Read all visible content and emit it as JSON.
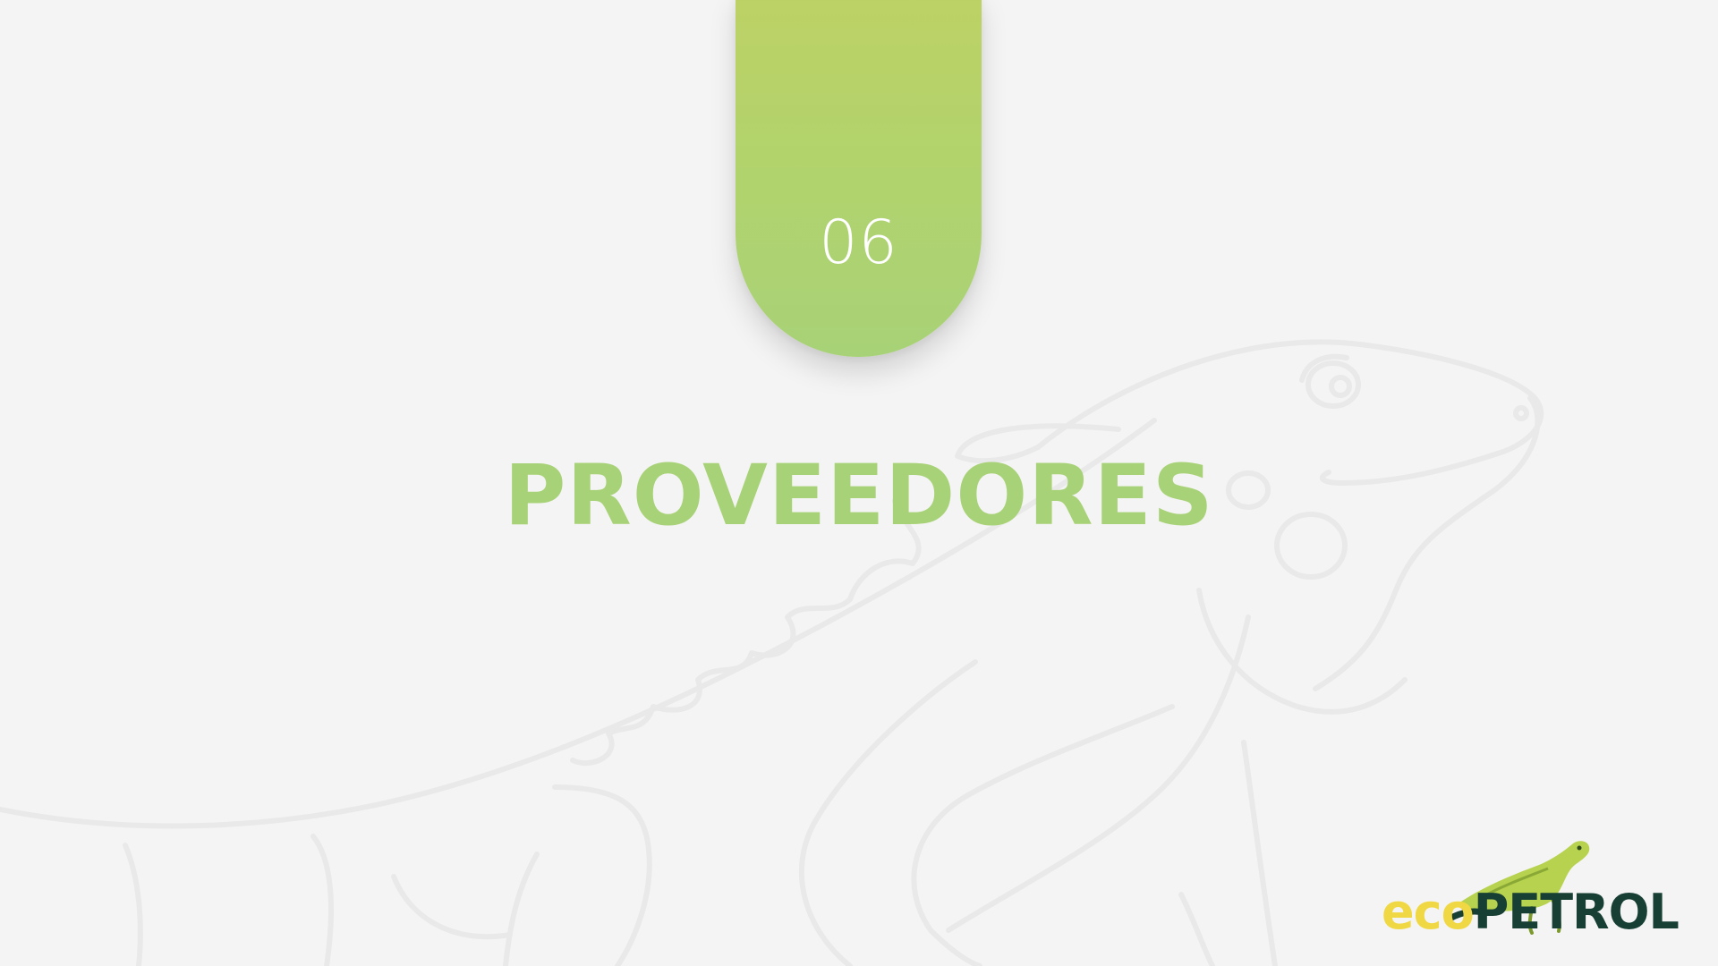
{
  "slide": {
    "section_number": "06",
    "section_title": "PROVEEDORES"
  },
  "logo": {
    "name": "ecopetrol",
    "icon": "iguana-logo-icon"
  },
  "watermark": {
    "icon": "iguana-outline-icon"
  },
  "colors": {
    "background": "#f4f4f4",
    "accent_green": "#a8d277",
    "tab_gradient_top": "#bdd165",
    "tab_gradient_bottom": "#a8d277",
    "logo_eco": "#f0d844",
    "logo_petrol": "#173f34"
  }
}
